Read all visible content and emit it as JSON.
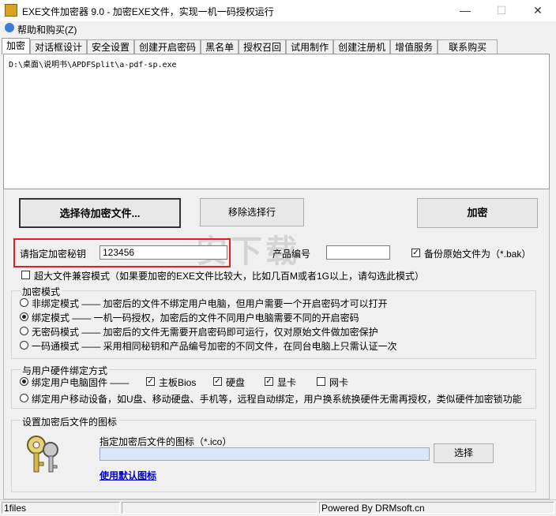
{
  "window": {
    "title": "EXE文件加密器 9.0 - 加密EXE文件，实现一机一码授权运行",
    "minimize": "—",
    "maximize": "☐",
    "close": "✕"
  },
  "menu": {
    "help": "帮助和购买(Z)"
  },
  "tabs": [
    "加密",
    "对话框设计",
    "安全设置",
    "创建开启密码",
    "黑名单",
    "授权召回",
    "试用制作",
    "创建注册机",
    "增值服务",
    "联系购买"
  ],
  "file_list": {
    "items": [
      "D:\\桌面\\说明书\\APDFSplit\\a-pdf-sp.exe"
    ]
  },
  "buttons": {
    "select_file": "选择待加密文件...",
    "remove_row": "移除选择行",
    "encrypt": "加密",
    "choose_icon": "选择",
    "use_default_icon": "使用默认图标"
  },
  "key": {
    "label": "请指定加密秘钥",
    "value": "123456"
  },
  "product": {
    "label": "产品编号",
    "value": ""
  },
  "backup": {
    "label": "备份原始文件为（*.bak）",
    "checked": true
  },
  "large_file": {
    "label": "超大文件兼容模式（如果要加密的EXE文件比较大，比如几百M或者1G以上，请勾选此模式）",
    "checked": false
  },
  "encrypt_mode": {
    "title": "加密模式",
    "options": [
      {
        "label": "非绑定模式 —— 加密后的文件不绑定用户电脑，但用户需要一个开启密码才可以打开",
        "selected": false
      },
      {
        "label": "绑定模式 —— 一机一码授权，加密后的文件不同用户电脑需要不同的开启密码",
        "selected": true
      },
      {
        "label": "无密码模式 —— 加密后的文件无需要开启密码即可运行，仅对原始文件做加密保护",
        "selected": false
      },
      {
        "label": "一码通模式 —— 采用相同秘钥和产品编号加密的不同文件，在同台电脑上只需认证一次",
        "selected": false
      }
    ]
  },
  "hardware": {
    "title": "与用户硬件绑定方式",
    "pc_label": "绑定用户电脑固件 ——",
    "pc_selected": true,
    "mainboard": {
      "label": "主板Bios",
      "checked": true
    },
    "disk": {
      "label": "硬盘",
      "checked": true
    },
    "gpu": {
      "label": "显卡",
      "checked": true
    },
    "nic": {
      "label": "网卡",
      "checked": false
    },
    "mobile_label": "绑定用户移动设备，如U盘、移动硬盘、手机等，远程自动绑定，用户换系统换硬件无需再授权，类似硬件加密锁功能",
    "mobile_selected": false
  },
  "icon_setting": {
    "title": "设置加密后文件的图标",
    "label": "指定加密后文件的图标（*.ico）",
    "path": ""
  },
  "status": {
    "files": "1files",
    "powered": "Powered By DRMsoft.cn"
  },
  "watermark": "安下载",
  "colors": {
    "highlight_box": "#e02020",
    "link": "#0000cc"
  }
}
